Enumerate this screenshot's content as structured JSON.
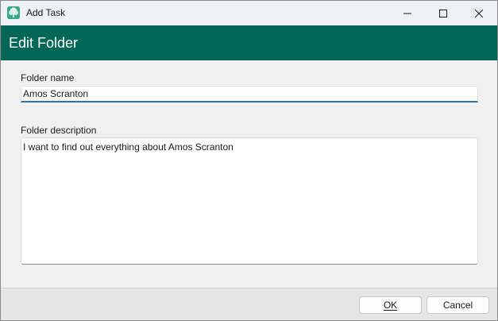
{
  "window": {
    "title": "Add Task",
    "app_icon": "tree-icon",
    "controls": [
      "minimize-icon",
      "maximize-icon",
      "close-icon"
    ]
  },
  "header": {
    "title": "Edit Folder",
    "background": "#006655"
  },
  "form": {
    "name_label": "Folder name",
    "name_value": "Amos Scranton",
    "description_label": "Folder description",
    "description_value": "I want to find out everything about Amos Scranton"
  },
  "footer": {
    "ok_label": "OK",
    "cancel_label": "Cancel"
  },
  "colors": {
    "accent": "#006655",
    "focus_underline": "#2f6eb0"
  }
}
